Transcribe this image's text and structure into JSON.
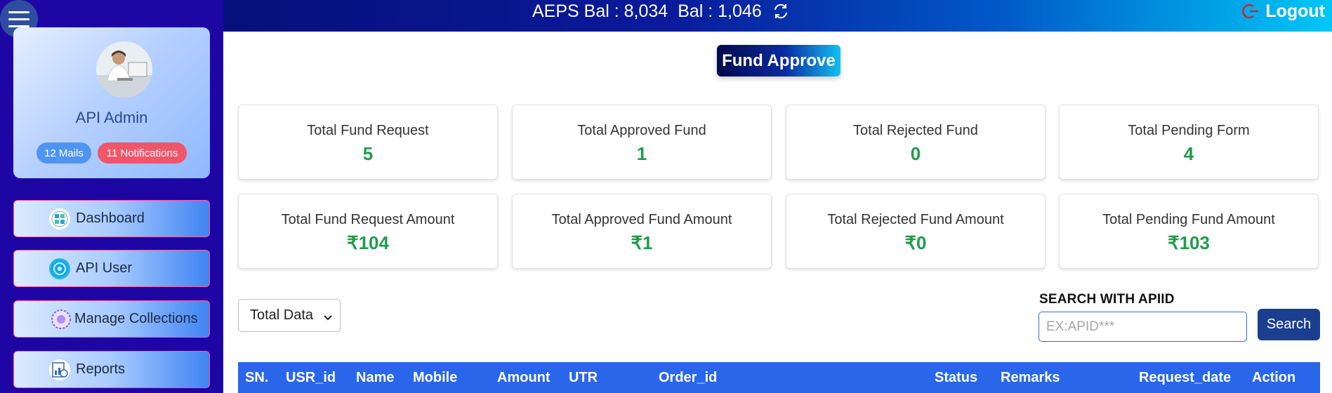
{
  "header": {
    "aeps_label": "AEPS Bal",
    "aeps_value": "8,034",
    "bal_label": "Bal",
    "bal_value": "1,046",
    "refresh_icon": "refresh-icon",
    "logout_icon": "power-icon",
    "logout_label": "Logout"
  },
  "sidebar": {
    "menu_icon": "hamburger-icon",
    "profile": {
      "name": "API Admin",
      "mails_badge": "12 Mails",
      "notifications_badge": "11 Notifications"
    },
    "items": [
      {
        "label": "Dashboard",
        "icon": "dashboard-icon"
      },
      {
        "label": "API User",
        "icon": "api-user-icon"
      },
      {
        "label": "Manage Collections",
        "icon": "collections-icon"
      },
      {
        "label": "Reports",
        "icon": "reports-icon"
      }
    ]
  },
  "page": {
    "title": "Fund Approve"
  },
  "stats": [
    {
      "label": "Total Fund Request",
      "value": "5"
    },
    {
      "label": "Total Approved Fund",
      "value": "1"
    },
    {
      "label": "Total Rejected Fund",
      "value": "0"
    },
    {
      "label": "Total Pending Form",
      "value": "4"
    },
    {
      "label": "Total Fund Request Amount",
      "value": "₹104"
    },
    {
      "label": "Total Approved Fund Amount",
      "value": "₹1"
    },
    {
      "label": "Total Rejected Fund Amount",
      "value": "₹0"
    },
    {
      "label": "Total Pending Fund Amount",
      "value": "₹103"
    }
  ],
  "filter": {
    "selected": "Total Data"
  },
  "search": {
    "label": "SEARCH WITH APIID",
    "placeholder": "EX:APID***",
    "button_label": "Search"
  },
  "table": {
    "columns": [
      "SN.",
      "USR_id",
      "Name",
      "Mobile",
      "Amount",
      "UTR",
      "Order_id",
      "Status",
      "Remarks",
      "Request_date",
      "Action"
    ]
  },
  "colors": {
    "sidebar_bg": "#1e06a5",
    "accent_green": "#1f9d4b",
    "table_header": "#2a66ea",
    "search_button": "#1c3e8e"
  }
}
